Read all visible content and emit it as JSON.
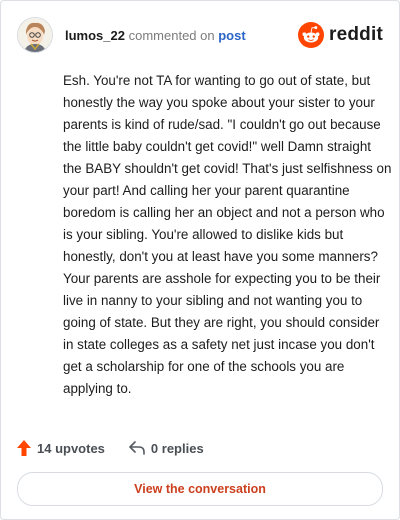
{
  "comment": {
    "username": "lumos_22",
    "action_text": "commented on",
    "post_link_label": "post",
    "body": "Esh. You're not TA for wanting to go out of state, but honestly the way you spoke about your sister to your parents is kind of rude/sad. \"I couldn't go out because the little baby couldn't get covid!\" well Damn straight the BABY shouldn't get covid! That's just selfishness on your part! And calling her your parent quarantine boredom is calling her an object and not a person who is your sibling. You're allowed to dislike kids but honestly, don't you at least have you some manners? Your parents are asshole for expecting you to be their live in nanny to your sibling and not wanting you to going of state. But they are right, you should consider in state colleges as a safety net just incase you don't get a scholarship for one of the schools you are applying to."
  },
  "brand": {
    "name": "reddit",
    "accent_color": "#ff4500"
  },
  "stats": {
    "upvotes_label": "14 upvotes",
    "replies_label": "0 replies",
    "upvote_color": "#ff4500"
  },
  "cta": {
    "label": "View the conversation",
    "color": "#cc3f1d"
  },
  "icons": [
    "avatar-icon",
    "reddit-logo-icon",
    "upvote-arrow-icon",
    "reply-arrow-icon"
  ]
}
